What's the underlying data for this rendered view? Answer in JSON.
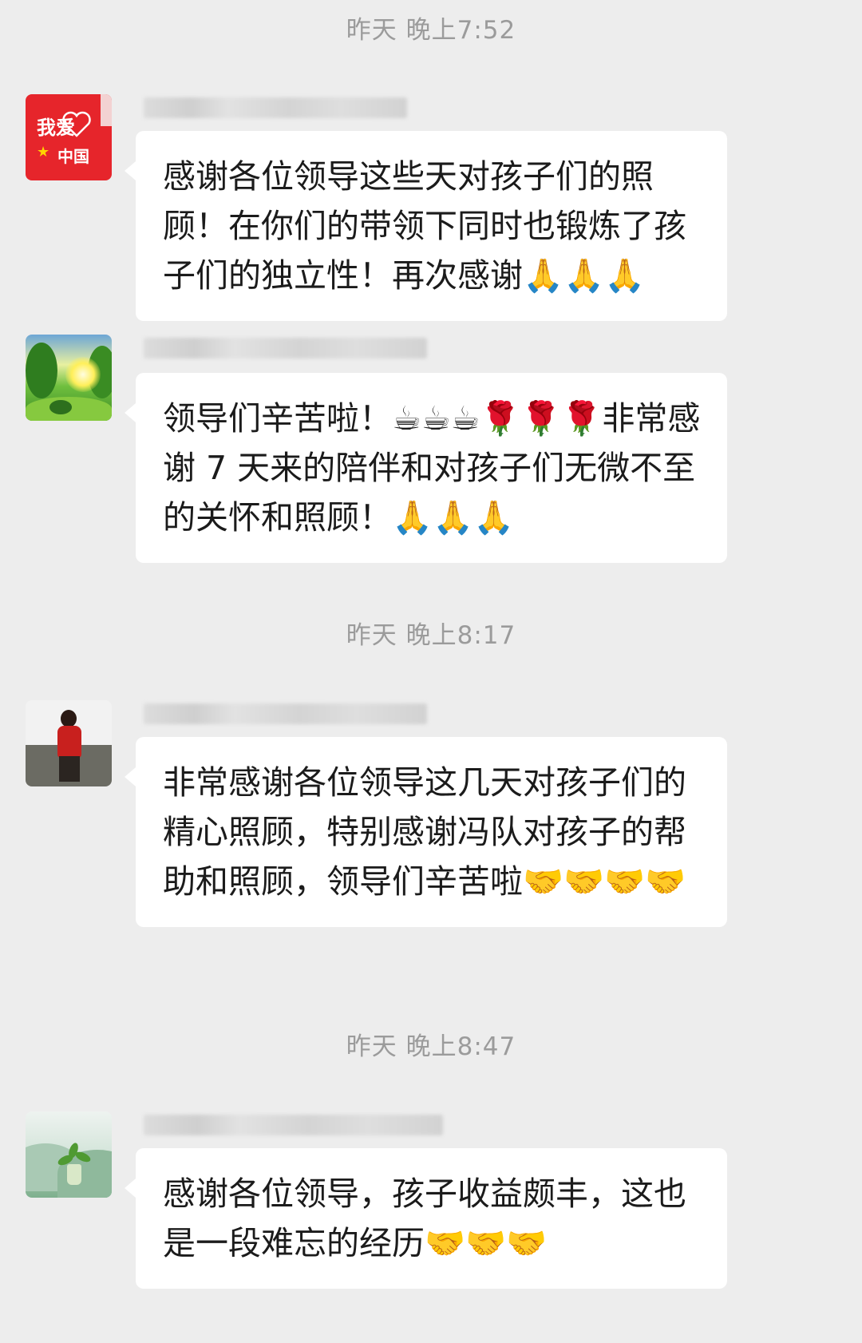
{
  "timestamps": {
    "first": "昨天 晚上7:52",
    "second": "昨天 晚上8:17",
    "third": "昨天 晚上8:47"
  },
  "messages": [
    {
      "avatar": "i-love-china-avatar",
      "avatar_text_top": "我爱",
      "avatar_text_bottom": "中国",
      "text": "感谢各位领导这些天对孩子们的照顾！在你们的带领下同时也锻炼了孩子们的独立性！再次感谢🙏🙏🙏"
    },
    {
      "avatar": "landscape-avatar",
      "text": "领导们辛苦啦！☕☕☕🌹🌹🌹非常感谢 7 天来的陪伴和对孩子们无微不至的关怀和照顾！🙏🙏🙏"
    },
    {
      "avatar": "person-avatar",
      "text": "非常感谢各位领导这几天对孩子们的精心照顾，特别感谢冯队对孩子的帮助和照顾，领导们辛苦啦🤝🤝🤝🤝"
    },
    {
      "avatar": "plant-avatar",
      "text": "感谢各位领导，孩子收益颇丰，这也是一段难忘的经历🤝🤝🤝"
    }
  ],
  "colors": {
    "background": "#ededed",
    "bubble": "#ffffff",
    "timestamp": "#9b9b9b"
  }
}
